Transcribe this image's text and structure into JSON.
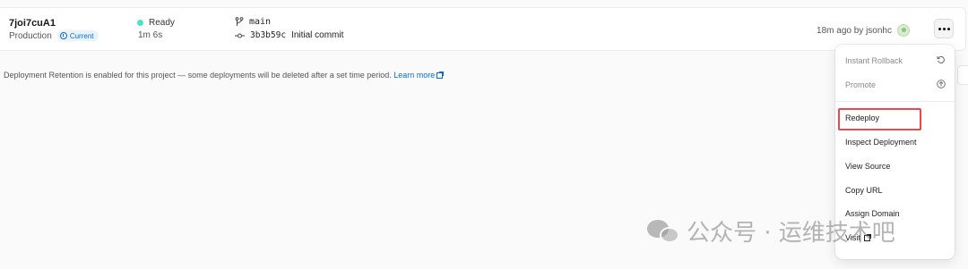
{
  "deployment": {
    "id": "7joi7cuA1",
    "environment": "Production",
    "badge": "Current",
    "status": "Ready",
    "duration": "1m 6s",
    "branch": "main",
    "commit_hash": "3b3b59c",
    "commit_message": "Initial commit",
    "time_ago": "18m ago by jsonhc",
    "status_color": "#50e3c2"
  },
  "notice": {
    "text": "Deployment Retention is enabled for this project — some deployments will be deleted after a set time period.",
    "link": "Learn more"
  },
  "menu": {
    "items": [
      {
        "label": "Instant Rollback",
        "enabled": false,
        "icon": "rollback-icon"
      },
      {
        "label": "Promote",
        "enabled": false,
        "icon": "promote-icon"
      },
      {
        "label": "Redeploy",
        "enabled": true,
        "highlighted": true
      },
      {
        "label": "Inspect Deployment",
        "enabled": true
      },
      {
        "label": "View Source",
        "enabled": true
      },
      {
        "label": "Copy URL",
        "enabled": true
      },
      {
        "label": "Assign Domain",
        "enabled": true
      },
      {
        "label": "Visit",
        "enabled": true,
        "icon": "external-link-icon"
      }
    ],
    "highlight_color": "#e5484d"
  },
  "watermark": {
    "text": "公众号 · 运维技术吧"
  }
}
